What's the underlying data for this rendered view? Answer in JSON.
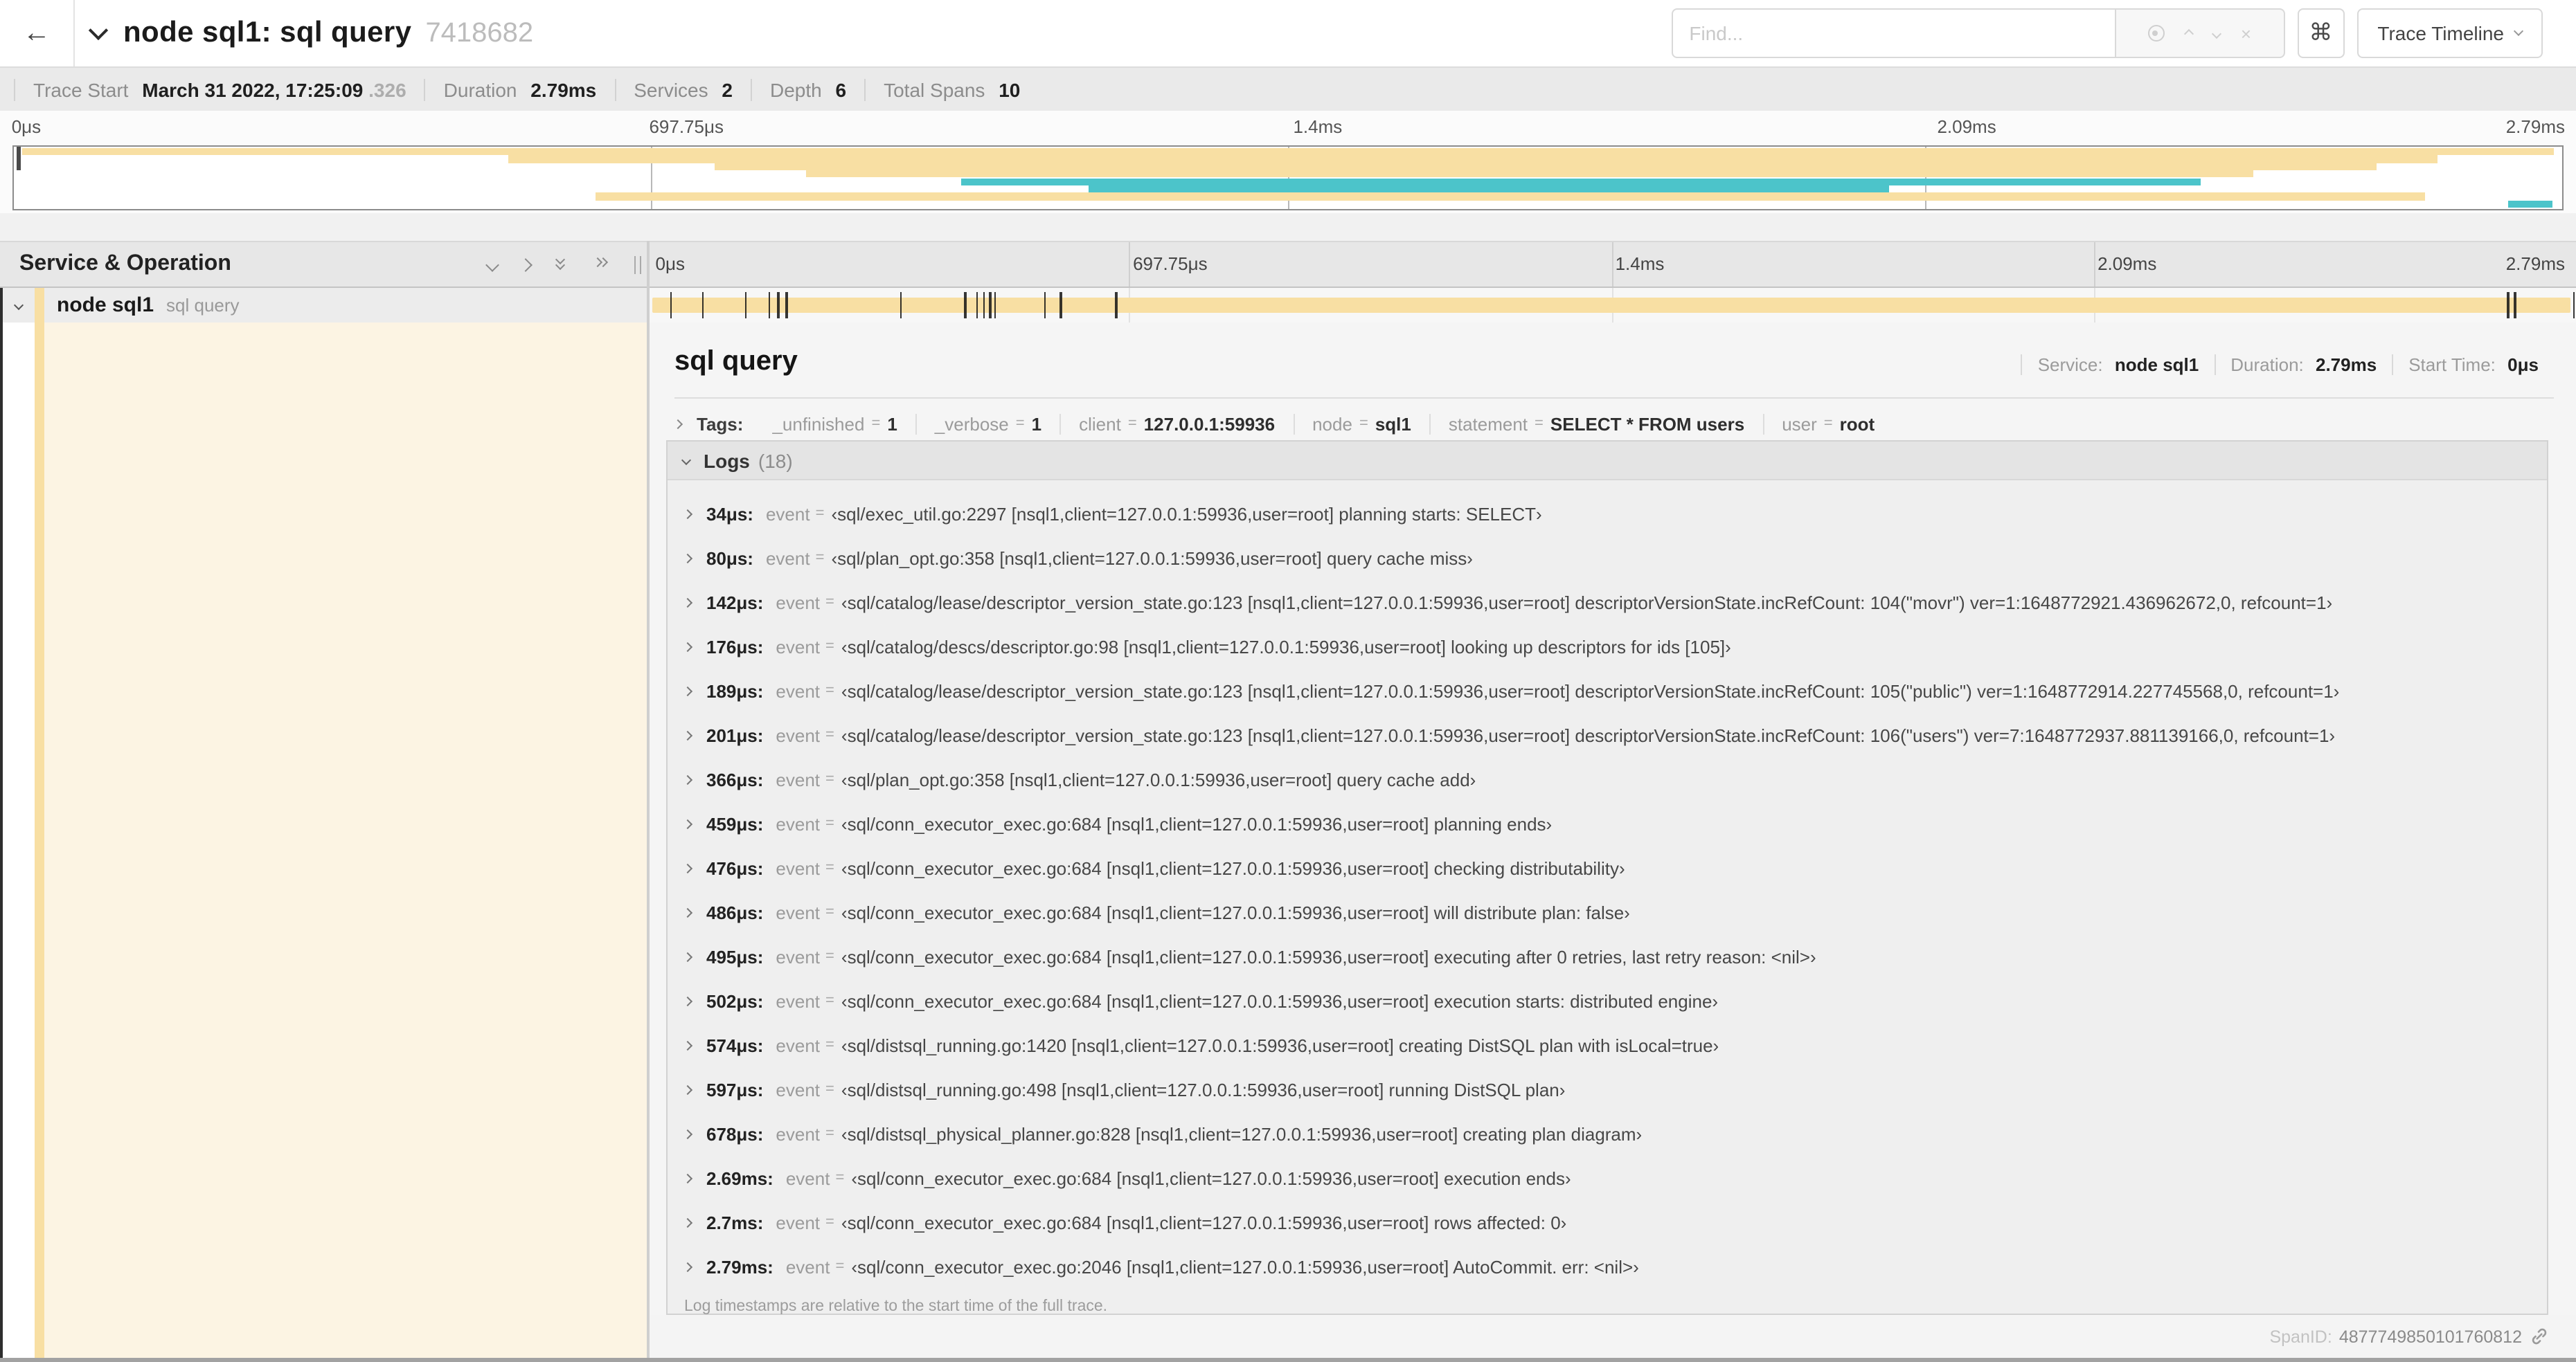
{
  "header": {
    "back_icon": "←",
    "title": "node sql1: sql query",
    "trace_id": "7418682",
    "find_placeholder": "Find...",
    "command_glyph": "⌘",
    "view_selector": "Trace Timeline"
  },
  "summary": {
    "items": [
      {
        "label": "Trace Start",
        "value": "March 31 2022, 17:25:09",
        "suffix": ".326"
      },
      {
        "label": "Duration",
        "value": "2.79ms",
        "suffix": ""
      },
      {
        "label": "Services",
        "value": "2",
        "suffix": ""
      },
      {
        "label": "Depth",
        "value": "6",
        "suffix": ""
      },
      {
        "label": "Total Spans",
        "value": "10",
        "suffix": ""
      }
    ]
  },
  "timeline": {
    "section_title": "Service & Operation",
    "ticks": [
      {
        "label": "0μs",
        "left": "0.45%"
      },
      {
        "label": "697.75μs",
        "left": "25.2%"
      },
      {
        "label": "1.4ms",
        "left": "50.2%"
      },
      {
        "label": "2.09ms",
        "left": "75.2%"
      }
    ],
    "end_label": "2.79ms"
  },
  "minimap": {
    "spans": [
      {
        "top": "2%",
        "left": "0.3%",
        "width": "99.4%",
        "color": "#f8dfa3"
      },
      {
        "top": "14%",
        "left": "19.4%",
        "width": "75.7%",
        "color": "#f8dfa3"
      },
      {
        "top": "26%",
        "left": "27.5%",
        "width": "65.2%",
        "color": "#f8dfa3"
      },
      {
        "top": "38%",
        "left": "31.1%",
        "width": "56.8%",
        "color": "#f8dfa3"
      },
      {
        "top": "50%",
        "left": "37.2%",
        "width": "48.6%",
        "color": "#4cc4ca"
      },
      {
        "top": "62%",
        "left": "42.2%",
        "width": "31.4%",
        "color": "#4cc4ca"
      },
      {
        "top": "74%",
        "left": "22.8%",
        "width": "71.8%",
        "color": "#f8dfa3"
      },
      {
        "top": "86%",
        "left": "97.9%",
        "width": "1.7%",
        "color": "#4cc4ca"
      }
    ]
  },
  "span_row": {
    "service": "node sql1",
    "operation": "sql query",
    "bar_color": "#f8dfa3",
    "log_ticks": [
      {
        "left": "1.22%"
      },
      {
        "left": "2.87%"
      },
      {
        "left": "5.09%"
      },
      {
        "left": "6.31%"
      },
      {
        "left": "6.77%"
      },
      {
        "left": "7.2%"
      },
      {
        "left": "13.12%"
      },
      {
        "left": "16.45%"
      },
      {
        "left": "17.06%"
      },
      {
        "left": "17.42%"
      },
      {
        "left": "17.74%"
      },
      {
        "left": "18.0%"
      },
      {
        "left": "20.57%"
      },
      {
        "left": "21.4%"
      },
      {
        "left": "24.3%"
      },
      {
        "left": "96.42%"
      },
      {
        "left": "96.77%"
      },
      {
        "left": "99.85%"
      }
    ]
  },
  "detail": {
    "title": "sql query",
    "stats": [
      {
        "label": "Service:",
        "value": "node sql1"
      },
      {
        "label": "Duration:",
        "value": "2.79ms"
      },
      {
        "label": "Start Time:",
        "value": "0μs"
      }
    ],
    "tags_label": "Tags:",
    "eq": "=",
    "tags": [
      {
        "key": "_unfinished",
        "value": "1"
      },
      {
        "key": "_verbose",
        "value": "1"
      },
      {
        "key": "client",
        "value": "127.0.0.1:59936"
      },
      {
        "key": "node",
        "value": "sql1"
      },
      {
        "key": "statement",
        "value": "SELECT * FROM users"
      },
      {
        "key": "user",
        "value": "root"
      }
    ]
  },
  "logs": {
    "label": "Logs",
    "count": "(18)",
    "field_label": "event",
    "eq": "=",
    "entries": [
      {
        "time": "34μs:",
        "message": "‹sql/exec_util.go:2297 [nsql1,client=127.0.0.1:59936,user=root] planning starts: SELECT›"
      },
      {
        "time": "80μs:",
        "message": "‹sql/plan_opt.go:358 [nsql1,client=127.0.0.1:59936,user=root] query cache miss›"
      },
      {
        "time": "142μs:",
        "message": "‹sql/catalog/lease/descriptor_version_state.go:123 [nsql1,client=127.0.0.1:59936,user=root] descriptorVersionState.incRefCount: 104(\"movr\") ver=1:1648772921.436962672,0, refcount=1›"
      },
      {
        "time": "176μs:",
        "message": "‹sql/catalog/descs/descriptor.go:98 [nsql1,client=127.0.0.1:59936,user=root] looking up descriptors for ids [105]›"
      },
      {
        "time": "189μs:",
        "message": "‹sql/catalog/lease/descriptor_version_state.go:123 [nsql1,client=127.0.0.1:59936,user=root] descriptorVersionState.incRefCount: 105(\"public\") ver=1:1648772914.227745568,0, refcount=1›"
      },
      {
        "time": "201μs:",
        "message": "‹sql/catalog/lease/descriptor_version_state.go:123 [nsql1,client=127.0.0.1:59936,user=root] descriptorVersionState.incRefCount: 106(\"users\") ver=7:1648772937.881139166,0, refcount=1›"
      },
      {
        "time": "366μs:",
        "message": "‹sql/plan_opt.go:358 [nsql1,client=127.0.0.1:59936,user=root] query cache add›"
      },
      {
        "time": "459μs:",
        "message": "‹sql/conn_executor_exec.go:684 [nsql1,client=127.0.0.1:59936,user=root] planning ends›"
      },
      {
        "time": "476μs:",
        "message": "‹sql/conn_executor_exec.go:684 [nsql1,client=127.0.0.1:59936,user=root] checking distributability›"
      },
      {
        "time": "486μs:",
        "message": "‹sql/conn_executor_exec.go:684 [nsql1,client=127.0.0.1:59936,user=root] will distribute plan: false›"
      },
      {
        "time": "495μs:",
        "message": "‹sql/conn_executor_exec.go:684 [nsql1,client=127.0.0.1:59936,user=root] executing after 0 retries, last retry reason: <nil>›"
      },
      {
        "time": "502μs:",
        "message": "‹sql/conn_executor_exec.go:684 [nsql1,client=127.0.0.1:59936,user=root] execution starts: distributed engine›"
      },
      {
        "time": "574μs:",
        "message": "‹sql/distsql_running.go:1420 [nsql1,client=127.0.0.1:59936,user=root] creating DistSQL plan with isLocal=true›"
      },
      {
        "time": "597μs:",
        "message": "‹sql/distsql_running.go:498 [nsql1,client=127.0.0.1:59936,user=root] running DistSQL plan›"
      },
      {
        "time": "678μs:",
        "message": "‹sql/distsql_physical_planner.go:828 [nsql1,client=127.0.0.1:59936,user=root] creating plan diagram›"
      },
      {
        "time": "2.69ms:",
        "message": "‹sql/conn_executor_exec.go:684 [nsql1,client=127.0.0.1:59936,user=root] execution ends›"
      },
      {
        "time": "2.7ms:",
        "message": "‹sql/conn_executor_exec.go:684 [nsql1,client=127.0.0.1:59936,user=root] rows affected: 0›"
      },
      {
        "time": "2.79ms:",
        "message": "‹sql/conn_executor_exec.go:2046 [nsql1,client=127.0.0.1:59936,user=root] AutoCommit. err: <nil>›"
      }
    ],
    "note": "Log timestamps are relative to the start time of the full trace."
  },
  "footer": {
    "spanid_label": "SpanID:",
    "spanid": "4877749850101760812"
  }
}
